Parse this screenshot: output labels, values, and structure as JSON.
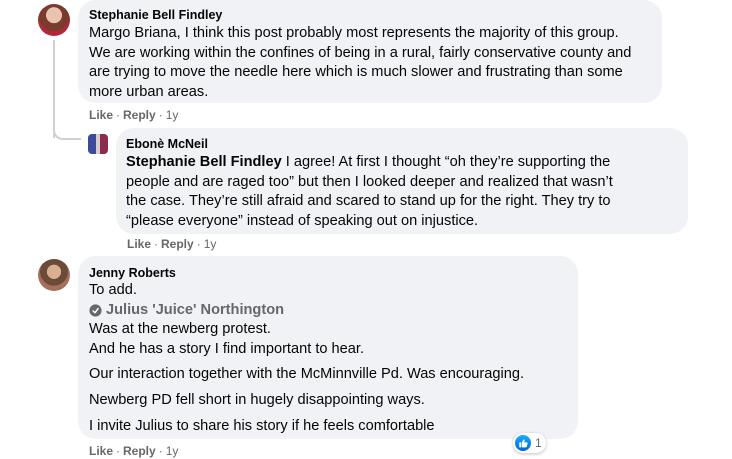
{
  "comments": [
    {
      "author": "Stephanie Bell Findley",
      "lines": [
        "Margo Briana, I think this post probably most represents the majority of this group.",
        "We are working within the confines of being in a rural, fairly conservative county and",
        "are trying to move the needle here which is much slower and frustrating than some",
        "more urban areas."
      ],
      "actions": {
        "like": "Like",
        "reply": "Reply",
        "time": "1y"
      }
    },
    {
      "author": "Ebonè McNeil",
      "mention": "Stephanie Bell Findley",
      "lines": [
        " I agree! At first I thought “oh they’re supporting the",
        "people and are raged too” but then I looked deeper and realized that wasn’t",
        "the case. They’re still afraid and scared to stand up for the right. They try to",
        "“please everyone” instead of speaking out on injustice."
      ],
      "actions": {
        "like": "Like",
        "reply": "Reply",
        "time": "1y"
      }
    },
    {
      "author": "Jenny Roberts",
      "intro": "To add.",
      "tagged": "Julius 'Juice' Northington",
      "paragraphs": [
        "Was at the newberg protest.",
        "And he has a story I find important to hear.",
        "Our interaction together with the McMinnville Pd. Was encouraging.",
        "Newberg PD fell short in hugely disappointing ways.",
        "I invite Julius to share his story if he feels comfortable"
      ],
      "reaction_count": "1",
      "actions": {
        "like": "Like",
        "reply": "Reply",
        "time": "1y"
      }
    }
  ],
  "colors": {
    "bubble": "#f0f2f5",
    "secondary_text": "#65676b",
    "like_blue": "#1877f2"
  },
  "icons": [
    "avatar-stephanie",
    "avatar-ebone",
    "avatar-jenny",
    "tag-icon",
    "like-reaction-icon"
  ]
}
